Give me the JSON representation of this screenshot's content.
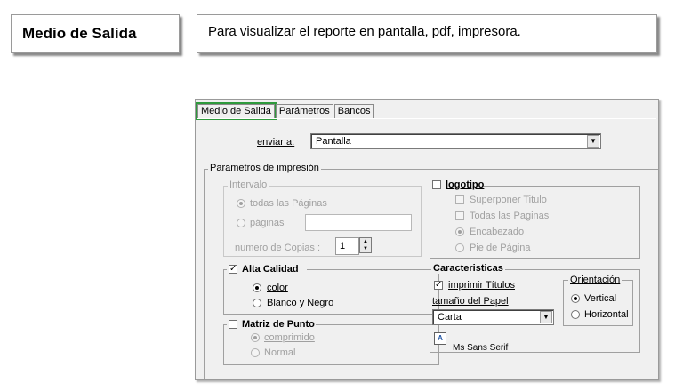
{
  "callouts": {
    "title": "Medio de Salida",
    "description": "Para visualizar el reporte en pantalla, pdf, impresora."
  },
  "tabs": [
    "Medio de Salida",
    "Parámetros",
    "Bancos"
  ],
  "enviar": {
    "label": "enviar a:",
    "value": "Pantalla"
  },
  "print_params": {
    "title": "Parametros de impresión",
    "intervalo": {
      "title": "Intervalo",
      "todas": "todas las Páginas",
      "paginas": "páginas",
      "copias_label": "numero de Copias :",
      "copias_value": "1"
    },
    "alta_calidad": {
      "title": "Alta Calidad",
      "checked": true,
      "color": "color",
      "bn": "Blanco y Negro"
    },
    "matriz": {
      "title": "Matriz de Punto",
      "comprimido": "comprimido",
      "normal": "Normal"
    },
    "logotipo": {
      "title": "logotipo",
      "superponer": "Superponer Titulo",
      "todas": "Todas las Paginas",
      "encabezado": "Encabezado",
      "pie": "Pie de Página"
    },
    "caracteristicas": {
      "title": "Caracteristicas",
      "imprimir": "imprimir Títulos",
      "tamano_label": "tamaño del Papel",
      "tamano_value": "Carta",
      "font_name": "Ms Sans Serif",
      "orientacion": {
        "title": "Orientación",
        "vertical": "Vertical",
        "horizontal": "Horizontal"
      }
    }
  }
}
